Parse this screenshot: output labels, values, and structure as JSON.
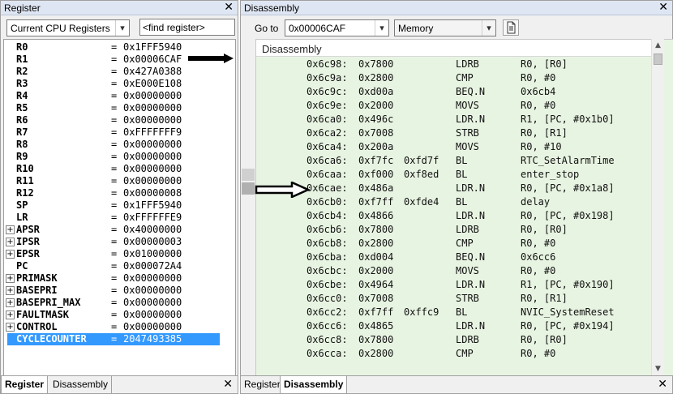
{
  "register_panel": {
    "title": "Register",
    "view_select": "Current CPU Registers",
    "find_placeholder": "<find register>",
    "rows": [
      {
        "name": "R0",
        "value": "0x1FFF5940",
        "expandable": false
      },
      {
        "name": "R1",
        "value": "0x00006CAF",
        "expandable": false
      },
      {
        "name": "R2",
        "value": "0x427A0388",
        "expandable": false
      },
      {
        "name": "R3",
        "value": "0xE000E108",
        "expandable": false
      },
      {
        "name": "R4",
        "value": "0x00000000",
        "expandable": false
      },
      {
        "name": "R5",
        "value": "0x00000000",
        "expandable": false
      },
      {
        "name": "R6",
        "value": "0x00000000",
        "expandable": false
      },
      {
        "name": "R7",
        "value": "0xFFFFFFF9",
        "expandable": false
      },
      {
        "name": "R8",
        "value": "0x00000000",
        "expandable": false
      },
      {
        "name": "R9",
        "value": "0x00000000",
        "expandable": false
      },
      {
        "name": "R10",
        "value": "0x00000000",
        "expandable": false
      },
      {
        "name": "R11",
        "value": "0x00000000",
        "expandable": false
      },
      {
        "name": "R12",
        "value": "0x00000008",
        "expandable": false
      },
      {
        "name": "SP",
        "value": "0x1FFF5940",
        "expandable": false
      },
      {
        "name": "LR",
        "value": "0xFFFFFFE9",
        "expandable": false
      },
      {
        "name": "APSR",
        "value": "0x40000000",
        "expandable": true
      },
      {
        "name": "IPSR",
        "value": "0x00000003",
        "expandable": true
      },
      {
        "name": "EPSR",
        "value": "0x01000000",
        "expandable": true
      },
      {
        "name": "PC",
        "value": "0x000072A4",
        "expandable": false
      },
      {
        "name": "PRIMASK",
        "value": "0x00000000",
        "expandable": true
      },
      {
        "name": "BASEPRI",
        "value": "0x00000000",
        "expandable": true
      },
      {
        "name": "BASEPRI_MAX",
        "value": "0x00000000",
        "expandable": true
      },
      {
        "name": "FAULTMASK",
        "value": "0x00000000",
        "expandable": true
      },
      {
        "name": "CONTROL",
        "value": "0x00000000",
        "expandable": true
      },
      {
        "name": "CYCLECOUNTER",
        "value": "2047493385",
        "expandable": false,
        "selected": true
      }
    ],
    "eq": "=",
    "expand_glyph": "+",
    "tabs": [
      "Register",
      "Disassembly"
    ],
    "active_tab": "Register"
  },
  "disassembly_panel": {
    "title": "Disassembly",
    "goto_label": "Go to",
    "goto_value": "0x00006CAF",
    "memory_select": "Memory",
    "header": "Disassembly",
    "rows": [
      {
        "addr": "0x6c98:",
        "code": "0x7800",
        "code2": "",
        "mnemonic": "LDRB",
        "operands": "R0, [R0]"
      },
      {
        "addr": "0x6c9a:",
        "code": "0x2800",
        "code2": "",
        "mnemonic": "CMP",
        "operands": "R0, #0"
      },
      {
        "addr": "0x6c9c:",
        "code": "0xd00a",
        "code2": "",
        "mnemonic": "BEQ.N",
        "operands": "0x6cb4"
      },
      {
        "addr": "0x6c9e:",
        "code": "0x2000",
        "code2": "",
        "mnemonic": "MOVS",
        "operands": "R0, #0"
      },
      {
        "addr": "0x6ca0:",
        "code": "0x496c",
        "code2": "",
        "mnemonic": "LDR.N",
        "operands": "R1, [PC, #0x1b0]"
      },
      {
        "addr": "0x6ca2:",
        "code": "0x7008",
        "code2": "",
        "mnemonic": "STRB",
        "operands": "R0, [R1]"
      },
      {
        "addr": "0x6ca4:",
        "code": "0x200a",
        "code2": "",
        "mnemonic": "MOVS",
        "operands": "R0, #10"
      },
      {
        "addr": "0x6ca6:",
        "code": "0xf7fc",
        "code2": "0xfd7f",
        "mnemonic": "BL",
        "operands": "RTC_SetAlarmTime"
      },
      {
        "addr": "0x6caa:",
        "code": "0xf000",
        "code2": "0xf8ed",
        "mnemonic": "BL",
        "operands": "enter_stop"
      },
      {
        "addr": "0x6cae:",
        "code": "0x486a",
        "code2": "",
        "mnemonic": "LDR.N",
        "operands": "R0, [PC, #0x1a8]"
      },
      {
        "addr": "0x6cb0:",
        "code": "0xf7ff",
        "code2": "0xfde4",
        "mnemonic": "BL",
        "operands": "delay"
      },
      {
        "addr": "0x6cb4:",
        "code": "0x4866",
        "code2": "",
        "mnemonic": "LDR.N",
        "operands": "R0, [PC, #0x198]"
      },
      {
        "addr": "0x6cb6:",
        "code": "0x7800",
        "code2": "",
        "mnemonic": "LDRB",
        "operands": "R0, [R0]"
      },
      {
        "addr": "0x6cb8:",
        "code": "0x2800",
        "code2": "",
        "mnemonic": "CMP",
        "operands": "R0, #0"
      },
      {
        "addr": "0x6cba:",
        "code": "0xd004",
        "code2": "",
        "mnemonic": "BEQ.N",
        "operands": "0x6cc6"
      },
      {
        "addr": "0x6cbc:",
        "code": "0x2000",
        "code2": "",
        "mnemonic": "MOVS",
        "operands": "R0, #0"
      },
      {
        "addr": "0x6cbe:",
        "code": "0x4964",
        "code2": "",
        "mnemonic": "LDR.N",
        "operands": "R1, [PC, #0x190]"
      },
      {
        "addr": "0x6cc0:",
        "code": "0x7008",
        "code2": "",
        "mnemonic": "STRB",
        "operands": "R0, [R1]"
      },
      {
        "addr": "0x6cc2:",
        "code": "0xf7ff",
        "code2": "0xffc9",
        "mnemonic": "BL",
        "operands": "NVIC_SystemReset"
      },
      {
        "addr": "0x6cc6:",
        "code": "0x4865",
        "code2": "",
        "mnemonic": "LDR.N",
        "operands": "R0, [PC, #0x194]"
      },
      {
        "addr": "0x6cc8:",
        "code": "0x7800",
        "code2": "",
        "mnemonic": "LDRB",
        "operands": "R0, [R0]"
      },
      {
        "addr": "0x6cca:",
        "code": "0x2800",
        "code2": "",
        "mnemonic": "CMP",
        "operands": "R0, #0"
      }
    ],
    "tabs": [
      "Register",
      "Disassembly"
    ],
    "active_tab": "Disassembly"
  },
  "icons": {
    "close": "close-icon",
    "dropdown": "chevron-down-icon",
    "document": "document-icon",
    "expand": "expand-icon",
    "annotation": "arrow-right-icon"
  },
  "colors": {
    "selection": "#3399ff",
    "disasm_background": "#e8f4e2",
    "titlebar": "#dfe6f3"
  },
  "glyphs": {
    "close": "✕",
    "dropdown": "▾"
  }
}
